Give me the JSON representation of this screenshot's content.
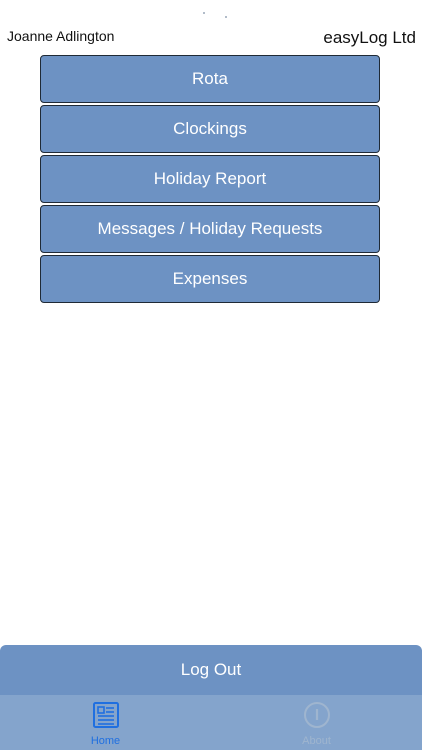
{
  "header": {
    "user_name": "Joanne Adlington",
    "company_name": "easyLog Ltd"
  },
  "menu": {
    "items": [
      {
        "label": "Rota"
      },
      {
        "label": "Clockings"
      },
      {
        "label": "Holiday Report"
      },
      {
        "label": "Messages / Holiday Requests"
      },
      {
        "label": "Expenses"
      }
    ]
  },
  "logout": {
    "label": "Log Out"
  },
  "tab_bar": {
    "tabs": [
      {
        "label": "Home",
        "icon": "newspaper-icon",
        "active": true
      },
      {
        "label": "About",
        "icon": "info-circle-icon",
        "active": false
      }
    ]
  },
  "colors": {
    "button_fill": "#6d92c3",
    "tab_bar_bg": "#84a4cc",
    "tab_active": "#1f6fe0",
    "tab_inactive": "#9fb5cf"
  }
}
